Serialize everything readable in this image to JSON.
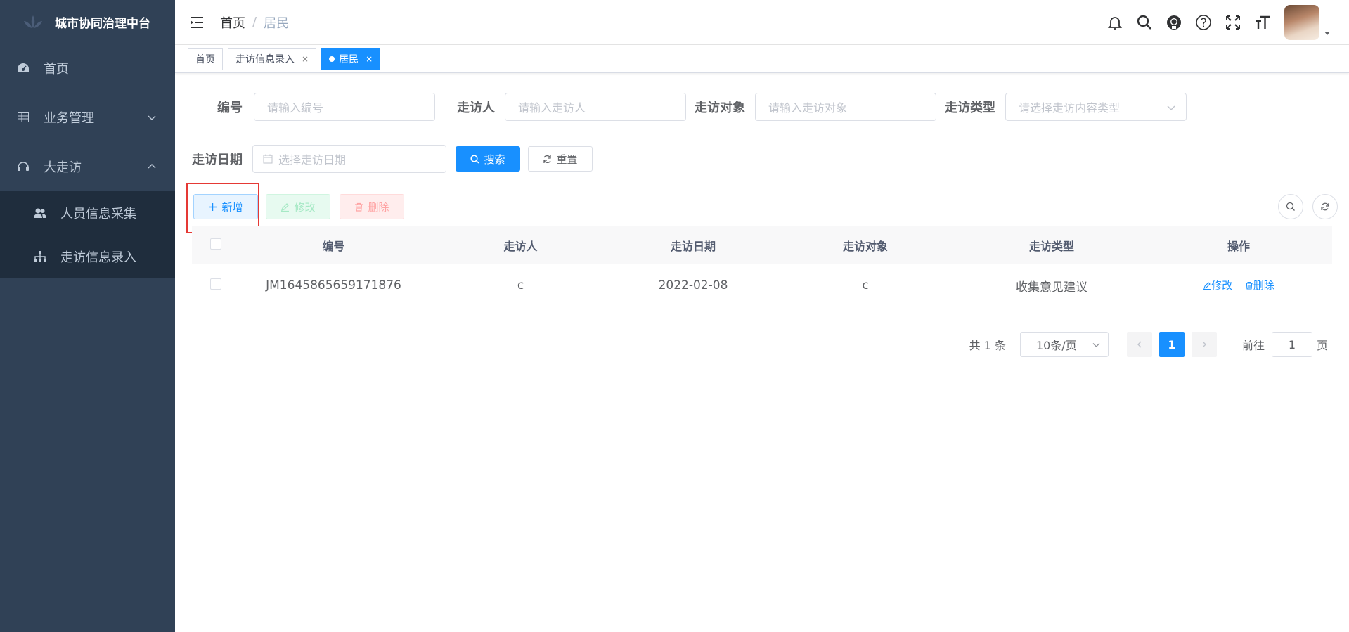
{
  "app": {
    "title": "城市协同治理中台"
  },
  "sidebar": {
    "items": [
      {
        "label": "首页",
        "icon": "dashboard-icon"
      },
      {
        "label": "业务管理",
        "icon": "table-icon"
      },
      {
        "label": "大走访",
        "icon": "headset-icon"
      }
    ],
    "sub_items": [
      {
        "label": "人员信息采集",
        "icon": "peoples-icon"
      },
      {
        "label": "走访信息录入",
        "icon": "tree-icon"
      }
    ]
  },
  "header": {
    "breadcrumb": [
      "首页",
      "居民"
    ]
  },
  "tags": {
    "items": [
      {
        "label": "首页"
      },
      {
        "label": "走访信息录入"
      },
      {
        "label": "居民"
      }
    ]
  },
  "search_form": {
    "code_label": "编号",
    "code_placeholder": "请输入编号",
    "visitor_label": "走访人",
    "visitor_placeholder": "请输入走访人",
    "target_label": "走访对象",
    "target_placeholder": "请输入走访对象",
    "type_label": "走访类型",
    "type_placeholder": "请选择走访内容类型",
    "date_label": "走访日期",
    "date_placeholder": "选择走访日期",
    "search_button": "搜索",
    "reset_button": "重置"
  },
  "toolbar": {
    "add_button": "新增",
    "edit_button": "修改",
    "delete_button": "删除"
  },
  "table": {
    "columns": [
      "编号",
      "走访人",
      "走访日期",
      "走访对象",
      "走访类型",
      "操作"
    ],
    "rows": [
      {
        "code": "JM1645865659171876",
        "visitor": "c",
        "date": "2022-02-08",
        "target": "c",
        "type": "收集意见建议",
        "edit": "修改",
        "delete": "删除"
      }
    ]
  },
  "pagination": {
    "total_text": "共 1 条",
    "page_size": "10条/页",
    "current_page": "1",
    "goto_label": "前往",
    "goto_value": "1",
    "page_suffix": "页"
  },
  "colors": {
    "sidebar_bg": "#304156",
    "submenu_bg": "#1f2d3d",
    "primary": "#1890ff",
    "highlight": "#e53935"
  }
}
